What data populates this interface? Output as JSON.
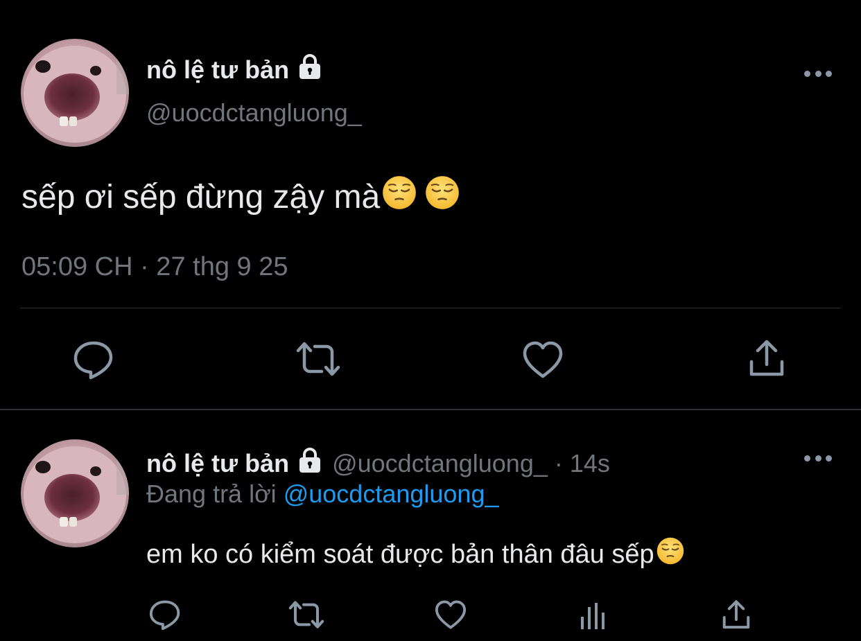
{
  "colors": {
    "background": "#000000",
    "primary_text": "#e7e9ea",
    "secondary_text": "#71767b",
    "icon": "#8b98a5",
    "accent": "#1d9bf0",
    "divider": "#2f3336"
  },
  "main_tweet": {
    "display_name": "nô lệ tư bản",
    "handle": "@uocdctangluong_",
    "text": "sếp ơi sếp đừng zậy mà",
    "emojis": [
      "pensive-face",
      "pensive-face"
    ],
    "timestamp": "05:09 CH · 27 thg 9 25",
    "actions": [
      "reply-icon",
      "retweet-icon",
      "like-icon",
      "share-icon"
    ]
  },
  "reply_tweet": {
    "display_name": "nô lệ tư bản",
    "handle": "@uocdctangluong_",
    "separator": "·",
    "time_ago": "14s",
    "replying_prefix": "Đang trả lời",
    "replying_to": "@uocdctangluong_",
    "text": "em ko có kiểm soát được bản thân đâu sếp",
    "emojis": [
      "pensive-face"
    ],
    "actions": [
      "reply-icon",
      "retweet-icon",
      "like-icon",
      "views-icon",
      "share-icon"
    ]
  }
}
